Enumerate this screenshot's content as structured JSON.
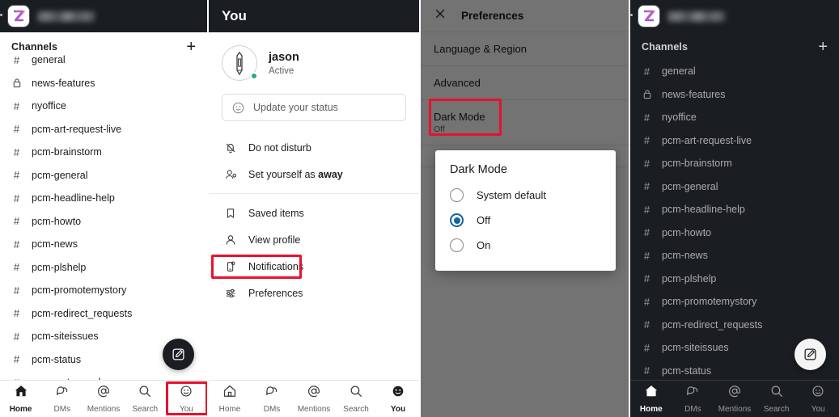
{
  "workspace": {
    "logo_letter": "Z",
    "logo_icon": "workspace-logo-icon",
    "name_redacted": ""
  },
  "channels_section": {
    "title": "Channels",
    "add_label": "+"
  },
  "panel1": {
    "channels": [
      {
        "glyph": "#",
        "name": "general",
        "private": false
      },
      {
        "glyph": "⌂",
        "name": "news-features",
        "private": true
      },
      {
        "glyph": "#",
        "name": "nyoffice",
        "private": false
      },
      {
        "glyph": "#",
        "name": "pcm-art-request-live",
        "private": false
      },
      {
        "glyph": "#",
        "name": "pcm-brainstorm",
        "private": false
      },
      {
        "glyph": "#",
        "name": "pcm-general",
        "private": false
      },
      {
        "glyph": "#",
        "name": "pcm-headline-help",
        "private": false
      },
      {
        "glyph": "#",
        "name": "pcm-howto",
        "private": false
      },
      {
        "glyph": "#",
        "name": "pcm-news",
        "private": false
      },
      {
        "glyph": "#",
        "name": "pcm-plshelp",
        "private": false
      },
      {
        "glyph": "#",
        "name": "pcm-promotemystory",
        "private": false
      },
      {
        "glyph": "#",
        "name": "pcm-redirect_requests",
        "private": false
      },
      {
        "glyph": "#",
        "name": "pcm-siteissues",
        "private": false
      },
      {
        "glyph": "#",
        "name": "pcm-status",
        "private": false
      },
      {
        "glyph": "#",
        "name": "pcm-water-cooler",
        "private": false
      }
    ],
    "compose_label": "compose-icon",
    "nav": [
      {
        "label": "Home",
        "icon": "home-icon",
        "active": true
      },
      {
        "label": "DMs",
        "icon": "dms-icon",
        "active": false
      },
      {
        "label": "Mentions",
        "icon": "at-icon",
        "active": false
      },
      {
        "label": "Search",
        "icon": "search-icon",
        "active": false
      },
      {
        "label": "You",
        "icon": "you-face-icon",
        "active": false
      }
    ],
    "highlight": "You"
  },
  "panel2": {
    "header_title": "You",
    "profile": {
      "name": "jason",
      "presence": "Active",
      "avatar_icon": "pen-avatar-icon"
    },
    "status_placeholder": "Update your status",
    "status_value": "",
    "status_icon": "smiley-icon",
    "menu_group_1": [
      {
        "label": "Do not disturb",
        "icon": "bell-slash-icon",
        "bold_tail": ""
      },
      {
        "label": "Set yourself as ",
        "icon": "person-away-icon",
        "bold_tail": "away"
      }
    ],
    "menu_group_2": [
      {
        "label": "Saved items",
        "icon": "bookmark-icon",
        "bold_tail": ""
      },
      {
        "label": "View profile",
        "icon": "person-icon",
        "bold_tail": ""
      },
      {
        "label": "Notifications",
        "icon": "notification-icon",
        "bold_tail": ""
      },
      {
        "label": "Preferences",
        "icon": "sliders-icon",
        "bold_tail": ""
      }
    ],
    "highlight": "Preferences",
    "nav": [
      {
        "label": "Home",
        "icon": "home-icon",
        "active": false
      },
      {
        "label": "DMs",
        "icon": "dms-icon",
        "active": false
      },
      {
        "label": "Mentions",
        "icon": "at-icon",
        "active": false
      },
      {
        "label": "Search",
        "icon": "search-icon",
        "active": false
      },
      {
        "label": "You",
        "icon": "you-face-icon",
        "active": true
      }
    ]
  },
  "panel3": {
    "header_title": "Preferences",
    "close_icon": "close-icon",
    "rows": [
      {
        "label": "Language & Region",
        "sub": ""
      },
      {
        "label": "Advanced",
        "sub": ""
      },
      {
        "label": "Dark Mode",
        "sub": "Off"
      }
    ],
    "highlight": "Dark Mode",
    "dialog": {
      "title": "Dark Mode",
      "options": [
        {
          "label": "System default",
          "selected": false
        },
        {
          "label": "Off",
          "selected": true
        },
        {
          "label": "On",
          "selected": false
        }
      ]
    }
  },
  "panel4": {
    "channels": [
      {
        "glyph": "#",
        "name": "general",
        "private": false
      },
      {
        "glyph": "⌂",
        "name": "news-features",
        "private": true
      },
      {
        "glyph": "#",
        "name": "nyoffice",
        "private": false
      },
      {
        "glyph": "#",
        "name": "pcm-art-request-live",
        "private": false
      },
      {
        "glyph": "#",
        "name": "pcm-brainstorm",
        "private": false
      },
      {
        "glyph": "#",
        "name": "pcm-general",
        "private": false
      },
      {
        "glyph": "#",
        "name": "pcm-headline-help",
        "private": false
      },
      {
        "glyph": "#",
        "name": "pcm-howto",
        "private": false
      },
      {
        "glyph": "#",
        "name": "pcm-news",
        "private": false
      },
      {
        "glyph": "#",
        "name": "pcm-plshelp",
        "private": false
      },
      {
        "glyph": "#",
        "name": "pcm-promotemystory",
        "private": false
      },
      {
        "glyph": "#",
        "name": "pcm-redirect_requests",
        "private": false
      },
      {
        "glyph": "#",
        "name": "pcm-siteissues",
        "private": false
      },
      {
        "glyph": "#",
        "name": "pcm-status",
        "private": false
      }
    ],
    "compose_label": "compose-icon",
    "nav": [
      {
        "label": "Home",
        "icon": "home-icon",
        "active": true
      },
      {
        "label": "DMs",
        "icon": "dms-icon",
        "active": false
      },
      {
        "label": "Mentions",
        "icon": "at-icon",
        "active": false
      },
      {
        "label": "Search",
        "icon": "search-icon",
        "active": false
      },
      {
        "label": "You",
        "icon": "you-face-icon",
        "active": false
      }
    ]
  },
  "colors": {
    "highlight_red": "#e8112d",
    "accent_blue": "#1264a3",
    "presence_green": "#2bac76",
    "dark_bg": "#1a1d21"
  }
}
